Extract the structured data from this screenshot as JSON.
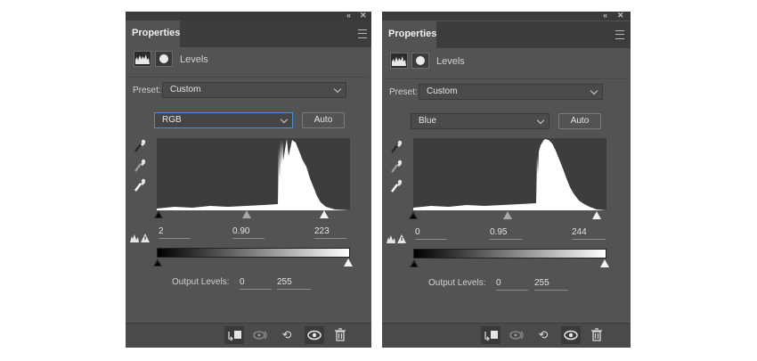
{
  "panels": [
    {
      "tab": "Properties",
      "title": "Levels",
      "preset_label": "Preset:",
      "preset_value": "Custom",
      "channel": "RGB",
      "auto_label": "Auto",
      "input_black": "2",
      "input_gamma": "0.90",
      "input_white": "223",
      "output_label": "Output Levels:",
      "output_black": "0",
      "output_white": "255",
      "histogram_peak_start": 0.61
    },
    {
      "tab": "Properties",
      "title": "Levels",
      "preset_label": "Preset:",
      "preset_value": "Custom",
      "channel": "Blue",
      "auto_label": "Auto",
      "input_black": "0",
      "input_gamma": "0.95",
      "input_white": "244",
      "output_label": "Output Levels:",
      "output_black": "0",
      "output_white": "255",
      "histogram_peak_start": 0.64
    }
  ],
  "icons": {
    "collapse": "«",
    "close": "✕",
    "cycle": "↻",
    "undo": "⟲",
    "eye": "◉",
    "trash": "🗑"
  }
}
